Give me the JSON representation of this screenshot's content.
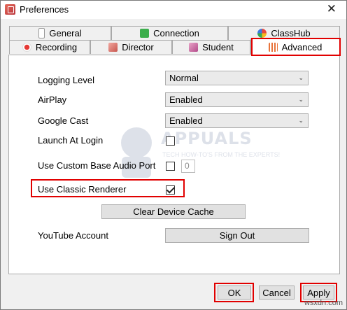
{
  "window": {
    "title": "Preferences",
    "close_glyph": "✕"
  },
  "tabs": {
    "row_back": [
      {
        "label": "General",
        "icon": "usb-icon"
      },
      {
        "label": "Connection",
        "icon": "refresh-icon"
      },
      {
        "label": "ClassHub",
        "icon": "classhub-icon"
      }
    ],
    "row_front": [
      {
        "label": "Recording",
        "icon": "record-icon"
      },
      {
        "label": "Director",
        "icon": "director-icon"
      },
      {
        "label": "Student",
        "icon": "student-icon"
      },
      {
        "label": "Advanced",
        "icon": "sliders-icon",
        "selected": true
      }
    ]
  },
  "settings": {
    "logging_level": {
      "label": "Logging Level",
      "value": "Normal"
    },
    "airplay": {
      "label": "AirPlay",
      "value": "Enabled"
    },
    "google_cast": {
      "label": "Google Cast",
      "value": "Enabled"
    },
    "launch_at_login": {
      "label": "Launch At Login",
      "checked": false
    },
    "custom_audio_port": {
      "label": "Use Custom Base Audio Port",
      "checked": false,
      "port_value": "0"
    },
    "classic_renderer": {
      "label": "Use Classic Renderer",
      "checked": true
    },
    "clear_cache_label": "Clear Device Cache",
    "youtube": {
      "label": "YouTube Account",
      "button": "Sign Out"
    }
  },
  "footer": {
    "ok": "OK",
    "cancel": "Cancel",
    "apply": "Apply"
  },
  "watermark": {
    "text": "APPUALS",
    "subtitle": "TECH HOW-TO'S FROM THE EXPERTS!"
  },
  "site_credit": "wsxdn.com",
  "colors": {
    "highlight": "#e10000",
    "panel": "#ffffff",
    "window_bg": "#f0f0f0"
  }
}
